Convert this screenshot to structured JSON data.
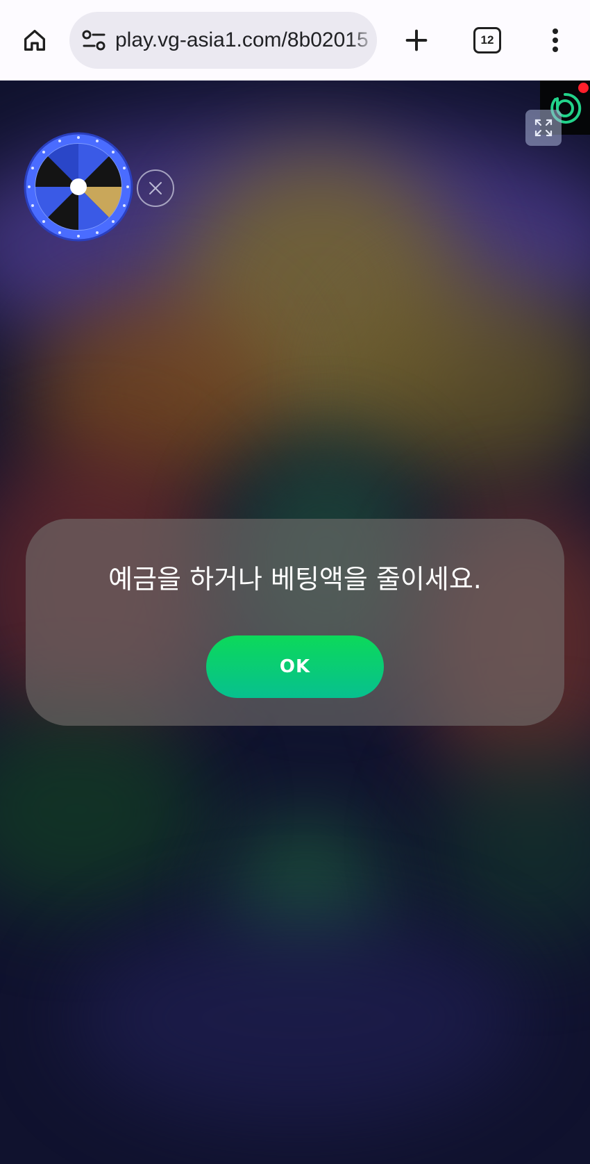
{
  "browser": {
    "url_text": "play.vg-asia1.com/8b02015",
    "tab_count": "12"
  },
  "dialog": {
    "message": "예금을 하거나 베팅액을 줄이세요.",
    "ok_label": "OK"
  },
  "colors": {
    "ok_button": "#0cd95a",
    "badge_accent": "#22d38a",
    "notification_dot": "#ff1f2b"
  }
}
